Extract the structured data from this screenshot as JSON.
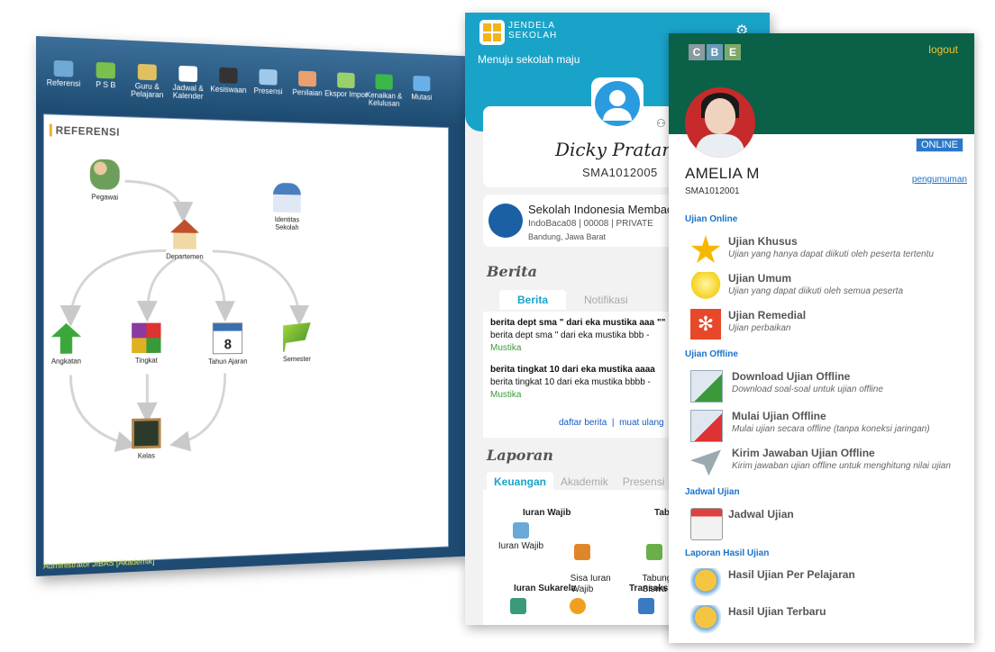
{
  "desktop": {
    "toolbar": [
      {
        "label": "Referensi",
        "icon": "reference-icon",
        "color": "#6fa9d6"
      },
      {
        "label": "P S B",
        "icon": "users-icon",
        "color": "#7ac04d"
      },
      {
        "label": "Guru &\nPelajaran",
        "icon": "teacher-icon",
        "color": "#e0c060"
      },
      {
        "label": "Jadwal &\nKalender",
        "icon": "calendar-icon",
        "color": "#ffffff"
      },
      {
        "label": "Kesiswaan",
        "icon": "student-icon",
        "color": "#333333"
      },
      {
        "label": "Presensi",
        "icon": "keyboard-icon",
        "color": "#a0c8e8"
      },
      {
        "label": "Penilaian",
        "icon": "handshake-icon",
        "color": "#e8a070"
      },
      {
        "label": "Ekspor Impor",
        "icon": "export-icon",
        "color": "#9ad06b"
      },
      {
        "label": "Kenaikan &\nKelulusan",
        "icon": "up-arrows-icon",
        "color": "#3cb84a"
      },
      {
        "label": "Mutasi",
        "icon": "transfer-icon",
        "color": "#6ab0e8"
      }
    ],
    "panel_title": "REFERENSI",
    "nodes": {
      "pegawai": "Pegawai",
      "identitas": "Identitas\nSekolah",
      "departemen": "Departemen",
      "angkatan": "Angkatan",
      "tingkat": "Tingkat",
      "tahun": "Tahun Ajaran",
      "semester": "Semester",
      "kelas": "Kelas"
    },
    "status": "Administrator JIBAS [Akademik]"
  },
  "phone1": {
    "app_name_line1": "JENDELA",
    "app_name_line2": "SEKOLAH",
    "tagline": "Menuju sekolah maju",
    "student_name": "Dicky Pratama",
    "student_nis": "SMA1012005",
    "school": {
      "name": "Sekolah Indonesia Membaca",
      "code": "IndoBaca08  |  00008  |  PRIVATE",
      "city": "Bandung, Jawa Barat"
    },
    "news_section": "Berita",
    "news_tabs": [
      "Berita",
      "Notifikasi"
    ],
    "news": [
      {
        "title": "berita dept sma \" dari eka mustika aaa \"\"",
        "body": "berita dept sma \" dari eka mustika bbb -",
        "author": "Mustika"
      },
      {
        "title": "berita tingkat 10 dari eka mustika aaaa",
        "body": "berita tingkat 10 dari eka mustika bbbb -",
        "author": "Mustika"
      }
    ],
    "news_link_all": "daftar berita",
    "news_link_more": "muat ulang",
    "report_section": "Laporan",
    "report_tabs": [
      "Keuangan",
      "Akademik",
      "Presensi"
    ],
    "report": {
      "group1": "Iuran Wajib",
      "group2": "Tabungan",
      "group3": "Iuran Sukarela",
      "group4": "Transaksi",
      "item1": "Iuran Wajib",
      "item2": "Sisa Iuran\nWajib",
      "item3": "Tabungan\nSiswa"
    }
  },
  "phone2": {
    "brand": [
      "C",
      "B",
      "E"
    ],
    "brand_colors": [
      "#8a9aa0",
      "#6a9ab8",
      "#7ea86a"
    ],
    "logout": "logout",
    "status": "ONLINE",
    "name": "AMELIA M",
    "nis": "SMA1012001",
    "announce": "pengumuman",
    "sections": {
      "online": "Ujian Online",
      "offline": "Ujian Offline",
      "schedule": "Jadwal Ujian",
      "report": "Laporan Hasil Ujian"
    },
    "menu": {
      "khusus": {
        "title": "Ujian Khusus",
        "sub": "Ujian yang hanya dapat diikuti oleh peserta tertentu",
        "icon": "star-icon"
      },
      "umum": {
        "title": "Ujian Umum",
        "sub": "Ujian yang dapat diikuti oleh semua peserta",
        "icon": "bulb-icon"
      },
      "remedial": {
        "title": "Ujian Remedial",
        "sub": "Ujian perbaikan",
        "icon": "remedial-icon"
      },
      "download": {
        "title": "Download Ujian Offline",
        "sub": "Download soal-soal untuk ujian offline",
        "icon": "download-icon"
      },
      "mulai": {
        "title": "Mulai Ujian Offline",
        "sub": "Mulai ujian secara offline (tanpa koneksi jaringan)",
        "icon": "offline-test-icon"
      },
      "kirim": {
        "title": "Kirim Jawaban Ujian Offline",
        "sub": "Kirim jawaban ujian offline untuk menghitung nilai ujian",
        "icon": "paper-plane-icon"
      },
      "jadwal": {
        "title": "Jadwal Ujian",
        "icon": "calendar-clock-icon"
      },
      "perpelajaran": {
        "title": "Hasil Ujian Per Pelajaran",
        "icon": "badge-icon"
      },
      "terbaru": {
        "title": "Hasil Ujian Terbaru",
        "icon": "badge-icon"
      }
    }
  }
}
